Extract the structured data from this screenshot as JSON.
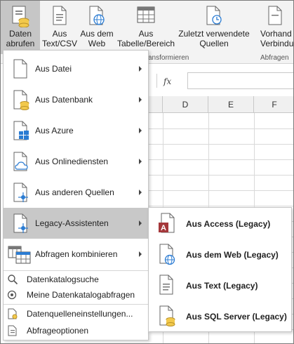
{
  "ribbon": {
    "get_data": {
      "line1": "Daten",
      "line2": "abrufen"
    },
    "from_text_csv": {
      "line1": "Aus",
      "line2": "Text/CSV"
    },
    "from_web": {
      "line1": "Aus dem",
      "line2": "Web"
    },
    "from_table": {
      "line1": "Aus",
      "line2": "Tabelle/Bereich"
    },
    "recent_sources": {
      "line1": "Zuletzt verwendete",
      "line2": "Quellen"
    },
    "existing_connections": {
      "line1": "Vorhand",
      "line2": "Verbindu"
    },
    "group_transform": "ansformieren",
    "group_queries": "Abfragen"
  },
  "formula_bar": {
    "fx": "fx"
  },
  "columns": [
    "D",
    "E",
    "F"
  ],
  "menu": {
    "items": [
      {
        "label": "Aus Datei",
        "icon": "file-icon"
      },
      {
        "label": "Aus Datenbank",
        "icon": "database-icon"
      },
      {
        "label": "Aus Azure",
        "icon": "azure-icon"
      },
      {
        "label": "Aus Onlinediensten",
        "icon": "cloud-icon"
      },
      {
        "label": "Aus anderen Quellen",
        "icon": "network-icon"
      },
      {
        "label": "Legacy-Assistenten",
        "icon": "legacy-icon"
      },
      {
        "label": "Abfragen kombinieren",
        "icon": "combine-icon"
      }
    ],
    "small_items": [
      {
        "label": "Datenkatalogsuche",
        "icon": "catalog-search-icon"
      },
      {
        "label": "Meine Datenkatalogabfragen",
        "icon": "catalog-queries-icon"
      },
      {
        "label": "Datenquelleneinstellungen...",
        "icon": "data-source-settings-icon"
      },
      {
        "label": "Abfrageoptionen",
        "icon": "query-options-icon"
      }
    ]
  },
  "submenu": {
    "items": [
      {
        "label": "Aus Access (Legacy)",
        "icon": "access-icon"
      },
      {
        "label": "Aus dem Web (Legacy)",
        "icon": "web-file-icon"
      },
      {
        "label": "Aus Text (Legacy)",
        "icon": "text-file-icon"
      },
      {
        "label": "Aus SQL Server (Legacy)",
        "icon": "sql-server-icon"
      }
    ]
  },
  "colors": {
    "highlight": "#c8c8c8",
    "accent_blue": "#2b7cd3",
    "access_red": "#a4373a",
    "db_yellow": "#f2c94c"
  }
}
